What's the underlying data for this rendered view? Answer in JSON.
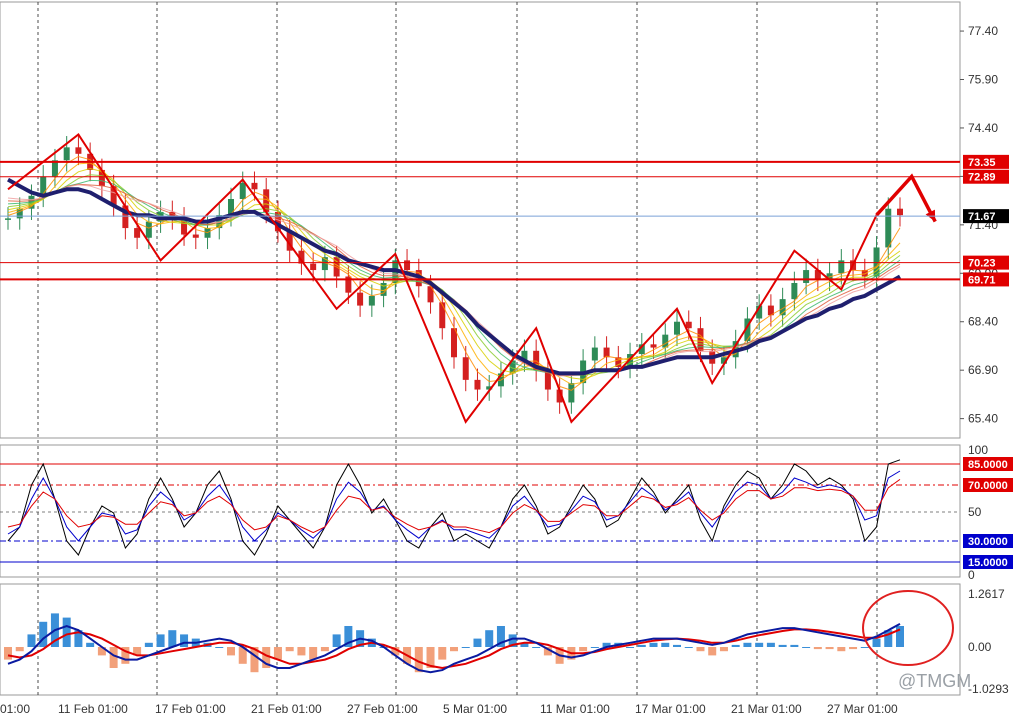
{
  "chart_data": {
    "type": "line",
    "price_panel": {
      "y_ticks": [
        "77.40",
        "75.90",
        "74.40",
        "72.90",
        "71.40",
        "69.90",
        "68.40",
        "66.90",
        "65.40"
      ],
      "ylim": [
        64.8,
        78.3
      ],
      "level_labels": [
        {
          "text": "73.35",
          "value": 73.35,
          "color": "#e00000"
        },
        {
          "text": "72.89",
          "value": 72.89,
          "color": "#e00000"
        },
        {
          "text": "71.67",
          "value": 71.67,
          "color": "#000000"
        },
        {
          "text": "70.23",
          "value": 70.23,
          "color": "#e00000"
        },
        {
          "text": "69.71",
          "value": 69.71,
          "color": "#e00000"
        }
      ],
      "price": [
        71.6,
        71.9,
        72.3,
        72.9,
        73.4,
        73.8,
        73.6,
        73.1,
        72.6,
        72.0,
        71.3,
        71.0,
        71.5,
        71.8,
        71.6,
        71.1,
        71.0,
        71.3,
        71.7,
        72.2,
        72.7,
        72.5,
        71.8,
        71.2,
        70.6,
        70.2,
        70.0,
        70.4,
        69.8,
        69.3,
        68.9,
        69.2,
        69.6,
        70.3,
        70.0,
        69.5,
        69.0,
        68.2,
        67.3,
        66.6,
        66.3,
        66.4,
        66.8,
        67.2,
        67.5,
        66.9,
        66.3,
        65.9,
        66.5,
        67.2,
        67.6,
        67.3,
        67.0,
        67.4,
        67.7,
        67.6,
        68.0,
        68.4,
        68.2,
        67.5,
        67.1,
        67.3,
        67.8,
        68.5,
        68.9,
        68.6,
        69.1,
        69.6,
        70.0,
        69.7,
        69.9,
        70.3,
        70.0,
        69.8,
        70.7,
        71.9,
        71.7
      ],
      "ma": [
        72.8,
        72.6,
        72.4,
        72.3,
        72.4,
        72.5,
        72.5,
        72.4,
        72.2,
        72.0,
        71.8,
        71.7,
        71.7,
        71.6,
        71.6,
        71.6,
        71.5,
        71.5,
        71.6,
        71.7,
        71.8,
        71.8,
        71.6,
        71.4,
        71.2,
        71.0,
        70.8,
        70.6,
        70.5,
        70.3,
        70.2,
        70.1,
        70.0,
        70.0,
        69.9,
        69.8,
        69.6,
        69.3,
        69.0,
        68.7,
        68.3,
        68.0,
        67.7,
        67.4,
        67.2,
        67.0,
        66.9,
        66.8,
        66.8,
        66.8,
        66.9,
        66.9,
        66.9,
        67.0,
        67.0,
        67.1,
        67.2,
        67.3,
        67.3,
        67.3,
        67.3,
        67.4,
        67.5,
        67.6,
        67.8,
        67.9,
        68.1,
        68.3,
        68.5,
        68.6,
        68.8,
        68.9,
        69.1,
        69.2,
        69.4,
        69.6,
        69.8
      ],
      "zigzag": [
        [
          0,
          72.5
        ],
        [
          6,
          74.2
        ],
        [
          13,
          70.3
        ],
        [
          20,
          72.8
        ],
        [
          28,
          68.8
        ],
        [
          33,
          70.5
        ],
        [
          39,
          65.3
        ],
        [
          45,
          68.2
        ],
        [
          48,
          65.3
        ],
        [
          57,
          68.8
        ],
        [
          60,
          66.5
        ],
        [
          67,
          70.6
        ],
        [
          71,
          69.4
        ],
        [
          74,
          71.7
        ]
      ],
      "projection": [
        [
          74,
          71.7
        ],
        [
          77,
          72.9
        ],
        [
          79,
          71.5
        ]
      ]
    },
    "rsi_panel": {
      "y_ticks": [
        "100",
        "50",
        "0"
      ],
      "ylim": [
        0,
        100
      ],
      "level_labels": [
        {
          "text": "85.0000",
          "value": 85,
          "color": "#e00000"
        },
        {
          "text": "70.0000",
          "value": 70,
          "color": "#e00000"
        },
        {
          "text": "30.0000",
          "value": 30,
          "color": "#0000cc"
        },
        {
          "text": "15.0000",
          "value": 15,
          "color": "#0000cc"
        }
      ],
      "fast": [
        30,
        40,
        70,
        85,
        60,
        30,
        20,
        40,
        55,
        50,
        25,
        35,
        60,
        75,
        60,
        40,
        50,
        70,
        80,
        60,
        30,
        20,
        35,
        55,
        45,
        35,
        25,
        40,
        70,
        85,
        70,
        50,
        60,
        45,
        30,
        25,
        40,
        50,
        30,
        35,
        30,
        25,
        40,
        60,
        70,
        55,
        35,
        40,
        55,
        70,
        60,
        40,
        45,
        60,
        75,
        65,
        50,
        60,
        70,
        45,
        30,
        55,
        70,
        80,
        75,
        60,
        70,
        85,
        80,
        70,
        75,
        70,
        60,
        30,
        40,
        85,
        88
      ],
      "slow": [
        35,
        40,
        60,
        75,
        60,
        40,
        30,
        40,
        50,
        48,
        35,
        38,
        55,
        65,
        58,
        45,
        50,
        62,
        70,
        58,
        40,
        30,
        38,
        50,
        45,
        38,
        32,
        40,
        60,
        72,
        65,
        52,
        55,
        45,
        38,
        32,
        40,
        45,
        38,
        38,
        35,
        32,
        40,
        55,
        62,
        52,
        40,
        42,
        52,
        62,
        58,
        45,
        48,
        58,
        68,
        62,
        52,
        58,
        65,
        50,
        40,
        52,
        65,
        72,
        70,
        60,
        65,
        75,
        72,
        68,
        70,
        68,
        62,
        45,
        48,
        75,
        80
      ],
      "signal": [
        40,
        42,
        55,
        65,
        60,
        48,
        40,
        42,
        48,
        47,
        42,
        42,
        50,
        58,
        56,
        48,
        50,
        58,
        62,
        56,
        45,
        38,
        40,
        48,
        45,
        40,
        36,
        40,
        52,
        62,
        60,
        52,
        54,
        47,
        42,
        38,
        40,
        44,
        40,
        40,
        38,
        36,
        40,
        50,
        56,
        52,
        44,
        44,
        50,
        56,
        55,
        48,
        48,
        55,
        62,
        60,
        54,
        56,
        61,
        52,
        45,
        50,
        60,
        66,
        66,
        60,
        62,
        68,
        68,
        66,
        67,
        66,
        62,
        52,
        52,
        68,
        74
      ]
    },
    "macd_panel": {
      "y_ticks": [
        "1.2617",
        "0.00",
        "-1.0293"
      ],
      "ylim": [
        -1.0293,
        1.2617
      ],
      "histogram": [
        -0.3,
        -0.1,
        0.3,
        0.6,
        0.8,
        0.7,
        0.4,
        0.1,
        -0.2,
        -0.5,
        -0.4,
        -0.2,
        0.1,
        0.3,
        0.4,
        0.3,
        0.2,
        0.1,
        0.0,
        -0.2,
        -0.4,
        -0.6,
        -0.5,
        -0.3,
        -0.1,
        -0.2,
        -0.3,
        -0.1,
        0.3,
        0.5,
        0.4,
        0.2,
        0.0,
        -0.2,
        -0.4,
        -0.6,
        -0.5,
        -0.3,
        -0.1,
        0.0,
        0.2,
        0.4,
        0.5,
        0.3,
        0.1,
        0.0,
        -0.2,
        -0.4,
        -0.3,
        -0.1,
        0.0,
        0.1,
        0.1,
        0.0,
        0.05,
        0.1,
        0.1,
        0.05,
        0.0,
        -0.1,
        -0.2,
        -0.1,
        0.05,
        0.1,
        0.1,
        0.1,
        0.05,
        0.05,
        0.0,
        -0.05,
        -0.05,
        -0.1,
        -0.05,
        0.0,
        0.2,
        0.4,
        0.5
      ],
      "macd": [
        -0.4,
        -0.3,
        -0.1,
        0.2,
        0.4,
        0.5,
        0.4,
        0.2,
        0.0,
        -0.2,
        -0.3,
        -0.3,
        -0.2,
        -0.1,
        0.0,
        0.1,
        0.1,
        0.15,
        0.2,
        0.15,
        0.0,
        -0.2,
        -0.4,
        -0.5,
        -0.5,
        -0.4,
        -0.3,
        -0.2,
        -0.05,
        0.1,
        0.2,
        0.15,
        0.0,
        -0.2,
        -0.4,
        -0.55,
        -0.6,
        -0.55,
        -0.4,
        -0.3,
        -0.2,
        -0.05,
        0.1,
        0.2,
        0.2,
        0.1,
        -0.05,
        -0.2,
        -0.25,
        -0.2,
        -0.1,
        0.0,
        0.05,
        0.1,
        0.15,
        0.2,
        0.2,
        0.2,
        0.15,
        0.1,
        0.05,
        0.1,
        0.2,
        0.3,
        0.35,
        0.4,
        0.45,
        0.45,
        0.4,
        0.35,
        0.3,
        0.25,
        0.2,
        0.15,
        0.25,
        0.4,
        0.55
      ],
      "signal": [
        -0.2,
        -0.25,
        -0.2,
        -0.05,
        0.15,
        0.3,
        0.35,
        0.3,
        0.2,
        0.05,
        -0.1,
        -0.2,
        -0.2,
        -0.15,
        -0.1,
        -0.05,
        0.0,
        0.05,
        0.1,
        0.1,
        0.05,
        -0.05,
        -0.2,
        -0.3,
        -0.4,
        -0.4,
        -0.35,
        -0.3,
        -0.2,
        -0.05,
        0.05,
        0.1,
        0.05,
        -0.05,
        -0.2,
        -0.35,
        -0.45,
        -0.5,
        -0.45,
        -0.4,
        -0.3,
        -0.2,
        -0.05,
        0.05,
        0.1,
        0.1,
        0.05,
        -0.05,
        -0.15,
        -0.15,
        -0.12,
        -0.05,
        0.0,
        0.05,
        0.1,
        0.15,
        0.18,
        0.2,
        0.18,
        0.15,
        0.1,
        0.1,
        0.15,
        0.22,
        0.28,
        0.33,
        0.38,
        0.42,
        0.42,
        0.4,
        0.36,
        0.32,
        0.27,
        0.22,
        0.22,
        0.3,
        0.42
      ]
    },
    "x_labels": [
      "01:00",
      "11 Feb 01:00",
      "17 Feb 01:00",
      "21 Feb 01:00",
      "27 Feb 01:00",
      "5 Mar 01:00",
      "11 Mar 01:00",
      "17 Mar 01:00",
      "21 Mar 01:00",
      "27 Mar 01:00"
    ],
    "grid": true
  },
  "watermark": {
    "text": "@TMGM"
  },
  "colors": {
    "level_line": "#e00000",
    "ma_line": "#1f1f6e",
    "candle_up": "#2e8b57",
    "candle_down": "#d42020",
    "macd_up": "#3a8fd8",
    "macd_down": "#f2a07a",
    "rsi_fast": "#000000",
    "rsi_slow": "#0000cc",
    "rsi_signal": "#e00000"
  }
}
